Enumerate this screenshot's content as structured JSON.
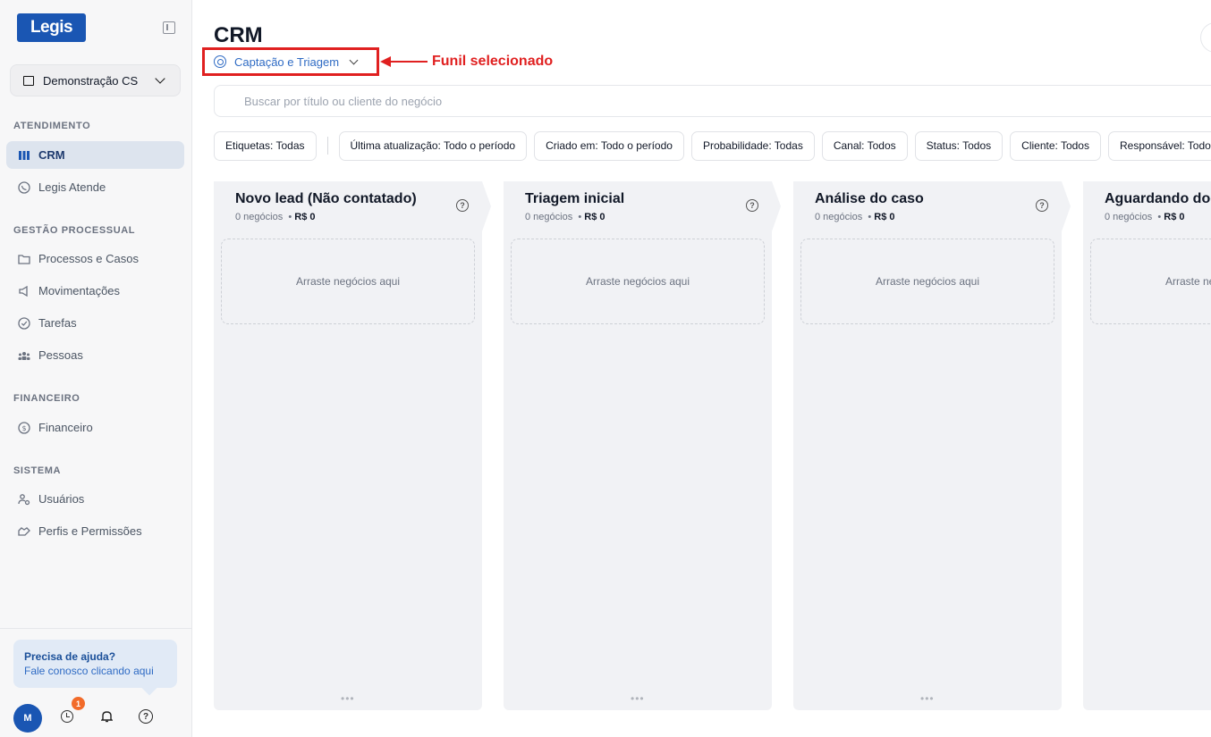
{
  "app": {
    "logo_text": "Legis",
    "colors": {
      "brand": "#1a56b3",
      "annotation": "#e02020",
      "badge": "#f26b2a"
    }
  },
  "sidebar": {
    "workspace": "Demonstração CS",
    "sections": [
      {
        "title": "ATENDIMENTO",
        "items": [
          {
            "label": "CRM",
            "icon": "kanban-icon",
            "active": true
          },
          {
            "label": "Legis Atende",
            "icon": "whatsapp-icon"
          }
        ]
      },
      {
        "title": "GESTÃO PROCESSUAL",
        "items": [
          {
            "label": "Processos e Casos",
            "icon": "folder-icon"
          },
          {
            "label": "Movimentações",
            "icon": "megaphone-icon"
          },
          {
            "label": "Tarefas",
            "icon": "check-circle-icon"
          },
          {
            "label": "Pessoas",
            "icon": "people-icon"
          }
        ]
      },
      {
        "title": "FINANCEIRO",
        "items": [
          {
            "label": "Financeiro",
            "icon": "dollar-circle-icon"
          }
        ]
      },
      {
        "title": "SISTEMA",
        "items": [
          {
            "label": "Usuários",
            "icon": "users-cog-icon"
          },
          {
            "label": "Perfis e Permissões",
            "icon": "handshake-icon"
          }
        ]
      }
    ],
    "help": {
      "title": "Precisa de ajuda?",
      "subtitle": "Fale conosco clicando aqui"
    },
    "avatar_initial": "M",
    "notification_count": "1"
  },
  "main": {
    "title": "CRM",
    "funnel": {
      "selected": "Captação e Triagem"
    },
    "annotation": "Funil selecionado",
    "search": {
      "placeholder": "Buscar por título ou cliente do negócio"
    },
    "filters": [
      "Etiquetas: Todas",
      "Última atualização: Todo o período",
      "Criado em: Todo o período",
      "Probabilidade: Todas",
      "Canal: Todos",
      "Status: Todos",
      "Cliente: Todos",
      "Responsável: Todos"
    ],
    "columns": [
      {
        "title": "Novo lead (Não contatado)",
        "count": "0 negócios",
        "value": "R$ 0",
        "dropzone": "Arraste negócios aqui"
      },
      {
        "title": "Triagem inicial",
        "count": "0 negócios",
        "value": "R$ 0",
        "dropzone": "Arraste negócios aqui"
      },
      {
        "title": "Análise do caso",
        "count": "0 negócios",
        "value": "R$ 0",
        "dropzone": "Arraste negócios aqui"
      },
      {
        "title": "Aguardando documentos",
        "count": "0 negócios",
        "value": "R$ 0",
        "dropzone": "Arraste negócios aqui"
      }
    ]
  }
}
